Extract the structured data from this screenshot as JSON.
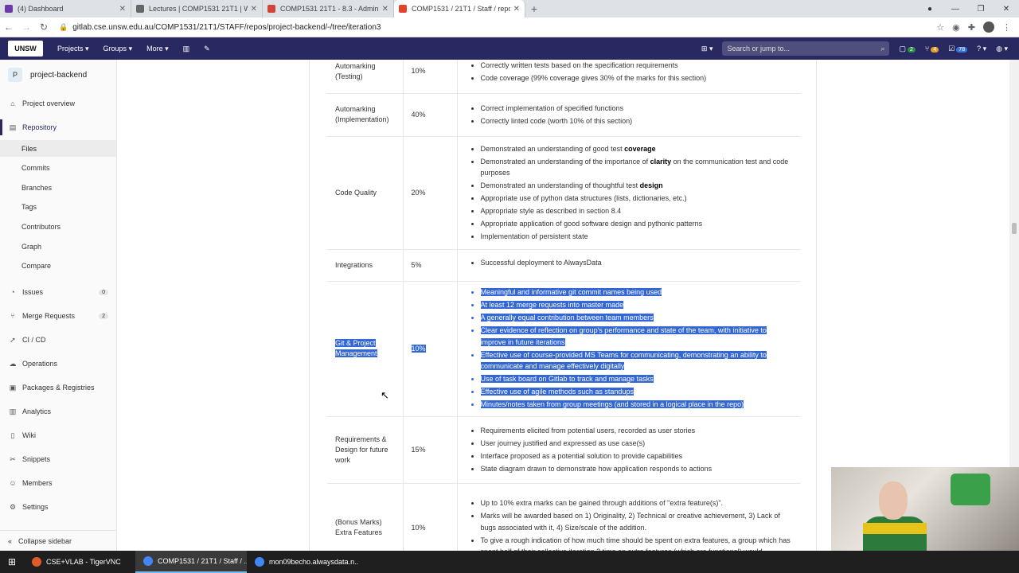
{
  "browser": {
    "tabs": [
      {
        "title": "(4) Dashboard",
        "color": "#6a3aa8",
        "active": false
      },
      {
        "title": "Lectures | COMP1531 21T1 | Web",
        "color": "#666666",
        "active": false
      },
      {
        "title": "COMP1531 21T1 - 8.3 - Admin -",
        "color": "#d0463b",
        "active": false
      },
      {
        "title": "COMP1531 / 21T1 / Staff / repos",
        "color": "#e2432a",
        "active": true
      }
    ],
    "new_tab": "+",
    "url": "gitlab.cse.unsw.edu.au/COMP1531/21T1/STAFF/repos/project-backend/-/tree/iteration3"
  },
  "gitlab_nav": {
    "logo": "UNSW",
    "menu": [
      "Projects",
      "Groups",
      "More"
    ],
    "search_placeholder": "Search or jump to...",
    "counts": {
      "issues": "2",
      "mrs": "4",
      "todos": "78"
    }
  },
  "sidebar": {
    "project_initial": "P",
    "project_name": "project-backend",
    "items": [
      {
        "label": "Project overview",
        "icon": "home-icon",
        "glyph": "⌂"
      },
      {
        "label": "Repository",
        "icon": "repo-icon",
        "glyph": "▤"
      },
      {
        "label": "Files",
        "sub": true
      },
      {
        "label": "Commits",
        "sub": true
      },
      {
        "label": "Branches",
        "sub": true
      },
      {
        "label": "Tags",
        "sub": true
      },
      {
        "label": "Contributors",
        "sub": true
      },
      {
        "label": "Graph",
        "sub": true
      },
      {
        "label": "Compare",
        "sub": true
      },
      {
        "label": "Issues",
        "icon": "issues-icon",
        "glyph": "◔",
        "count": "0"
      },
      {
        "label": "Merge Requests",
        "icon": "merge-icon",
        "glyph": "⑂",
        "count": "2"
      },
      {
        "label": "CI / CD",
        "icon": "rocket-icon",
        "glyph": "➚"
      },
      {
        "label": "Operations",
        "icon": "cloud-icon",
        "glyph": "☁"
      },
      {
        "label": "Packages & Registries",
        "icon": "package-icon",
        "glyph": "▣"
      },
      {
        "label": "Analytics",
        "icon": "chart-icon",
        "glyph": "▥"
      },
      {
        "label": "Wiki",
        "icon": "book-icon",
        "glyph": "▯"
      },
      {
        "label": "Snippets",
        "icon": "scissors-icon",
        "glyph": "✂"
      },
      {
        "label": "Members",
        "icon": "users-icon",
        "glyph": "☺"
      },
      {
        "label": "Settings",
        "icon": "gear-icon",
        "glyph": "⚙"
      }
    ],
    "collapse": "Collapse sidebar"
  },
  "rows": [
    {
      "name": "Automarking (Testing)",
      "weight": "10%",
      "bullets": [
        "Correctly written tests based on the specification requirements",
        "Code coverage (99% coverage gives 30% of the marks for this section)"
      ]
    },
    {
      "name": "Automarking (Implementation)",
      "weight": "40%",
      "bullets": [
        "Correct implementation of specified functions",
        "Correctly linted code (worth 10% of this section)"
      ]
    },
    {
      "name": "Code Quality",
      "weight": "20%",
      "bullets": [
        "Demonstrated an understanding of good test coverage",
        "Demonstrated an understanding of the importance of clarity on the communication test and code purposes",
        "Demonstrated an understanding of thoughtful test design",
        "Appropriate use of python data structures (lists, dictionaries, etc.)",
        "Appropriate style as described in section 8.4",
        "Appropriate application of good software design and pythonic patterns",
        "Implementation of persistent state"
      ]
    },
    {
      "name": "Integrations",
      "weight": "5%",
      "bullets": [
        "Successful deployment to AlwaysData"
      ]
    },
    {
      "name": "Git & Project Management",
      "weight": "10%",
      "bullets": [
        "Meaningful and informative git commit names being used",
        "At least 12 merge requests into master made",
        "A generally equal contribution between team members",
        "Clear evidence of reflection on group's performance and state of the team, with initiative to improve in future iterations",
        "Effective use of course-provided MS Teams for communicating, demonstrating an ability to communicate and manage effectively digitally",
        "Use of task board on Gitlab to track and manage tasks",
        "Effective use of agile methods such as standups",
        "Minutes/notes taken from group meetings (and stored in a logical place in the repo)"
      ]
    },
    {
      "name": "Requirements & Design for future work",
      "weight": "15%",
      "bullets": [
        "Requirements elicited from potential users, recorded as user stories",
        "User journey justified and expressed as use case(s)",
        "Interface proposed as a potential solution to provide capabilities",
        "State diagram drawn to demonstrate how application responds to actions"
      ]
    },
    {
      "name": "(Bonus Marks) Extra Features",
      "weight": "10%",
      "bullets": [
        "Up to 10% extra marks can be gained through additions of \"extra feature(s)\".",
        "Marks will be awarded based on 1) Originality, 2) Technical or creative achievement, 3) Lack of bugs associated with it, 4) Size/scale of the addition.",
        "To give a rough indication of how much time should be spent on extra features, a group which has spent half of their collective iteration 3 time on extra features (which are functional) would"
      ]
    }
  ],
  "taskbar": [
    {
      "label": "CSE+VLAB - TigerVNC",
      "color": "#e05a2b"
    },
    {
      "label": "COMP1531 / 21T1 / Staff / ...",
      "color": "#4285f4"
    },
    {
      "label": "mon09becho.alwaysdata.n...",
      "color": "#4285f4"
    }
  ]
}
